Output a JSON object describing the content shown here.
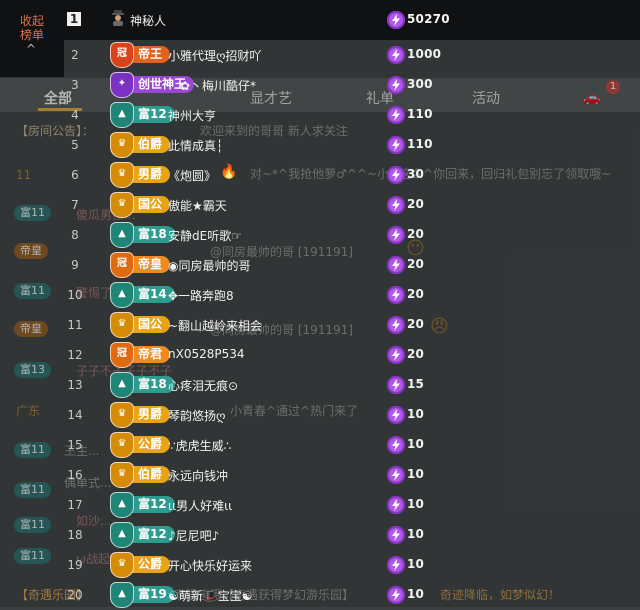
{
  "background": {
    "tabs": [
      "全部",
      "显才艺",
      "礼单",
      "活动"
    ],
    "tab_badge": "1",
    "announcement_label": "【房间公告】：",
    "announcement_text": "欢迎来到的哥哥 新人求关注",
    "chat_lines": [
      "11",
      "对~*^我抢他萝♂^^~小^这么^你回来，回归礼包别忘了领取哦~",
      "傻瓜男孩...",
      "@同房最帅的哥 [191191]",
      "警惕了...",
      "@同房最帅的哥 [191191]",
      "子子不子子子不子",
      "广东",
      "小青春^通过^热门来了",
      "王生...",
      "偶单式...",
      "如沙...",
      "ω战起...",
      "【奇遇乐园】",
      "跟大家同宝哦【奇遇获得梦幻游乐园】",
      "奇迹降临，如梦似幻！"
    ],
    "chips": [
      "富11",
      "帝皇",
      "富11",
      "帝皇",
      "富13",
      "富11",
      "富11",
      "富11",
      "富11"
    ]
  },
  "toggle": {
    "label": "收起榜单",
    "caret": "^"
  },
  "rankings": [
    {
      "rank": "1",
      "badge": "",
      "badge_color": "none",
      "name": "神秘人",
      "score": "50270"
    },
    {
      "rank": "2",
      "badge": "帝王",
      "badge_color": "#e0621e",
      "name": "小雅代理ღ招财吖",
      "score": "1000"
    },
    {
      "rank": "3",
      "badge": "创世神王",
      "badge_color": "#9a46d4",
      "name": "✿丶梅川酷仔*",
      "score": "300"
    },
    {
      "rank": "4",
      "badge": "富12",
      "badge_color": "#2e9b8f",
      "name": "神州大亨",
      "score": "110"
    },
    {
      "rank": "5",
      "badge": "伯爵",
      "badge_color": "#e8a418",
      "name": "此情成真┆",
      "score": "110"
    },
    {
      "rank": "6",
      "badge": "男爵",
      "badge_color": "#e8a418",
      "name": "《炮圆》",
      "score": "30"
    },
    {
      "rank": "7",
      "badge": "国公",
      "badge_color": "#e8a418",
      "name": "傲能★霸天",
      "score": "20"
    },
    {
      "rank": "8",
      "badge": "富18",
      "badge_color": "#2e9b8f",
      "name": "安静dE听歌☞",
      "score": "20"
    },
    {
      "rank": "9",
      "badge": "帝皇",
      "badge_color": "#ef8a1f",
      "name": "◉同房最帅的哥",
      "score": "20"
    },
    {
      "rank": "10",
      "badge": "富14",
      "badge_color": "#2e9b8f",
      "name": "✥一路奔跑8",
      "score": "20"
    },
    {
      "rank": "11",
      "badge": "国公",
      "badge_color": "#e8a418",
      "name": "~翻山越岭来相会",
      "score": "20"
    },
    {
      "rank": "12",
      "badge": "帝君",
      "badge_color": "#ef8a1f",
      "name": "nX0528P534",
      "score": "20"
    },
    {
      "rank": "13",
      "badge": "富18",
      "badge_color": "#2e9b8f",
      "name": "心疼泪无痕⊙",
      "score": "15"
    },
    {
      "rank": "14",
      "badge": "男爵",
      "badge_color": "#e8a418",
      "name": "琴韵悠扬ღ",
      "score": "10"
    },
    {
      "rank": "15",
      "badge": "公爵",
      "badge_color": "#e8a418",
      "name": "∵虎虎生威∴",
      "score": "10"
    },
    {
      "rank": "16",
      "badge": "伯爵",
      "badge_color": "#e8a418",
      "name": "永远向钱冲",
      "score": "10"
    },
    {
      "rank": "17",
      "badge": "富12",
      "badge_color": "#2e9b8f",
      "name": "ιι男人好难ιι",
      "score": "10"
    },
    {
      "rank": "18",
      "badge": "富12",
      "badge_color": "#2e9b8f",
      "name": "♪尼尼吧♪",
      "score": "10"
    },
    {
      "rank": "19",
      "badge": "公爵",
      "badge_color": "#e8a418",
      "name": "开心快乐好运来",
      "score": "10"
    },
    {
      "rank": "20",
      "badge": "富19",
      "badge_color": "#2e9b8f",
      "name": "☯萌新🎩宝宝☯",
      "score": "10"
    }
  ]
}
